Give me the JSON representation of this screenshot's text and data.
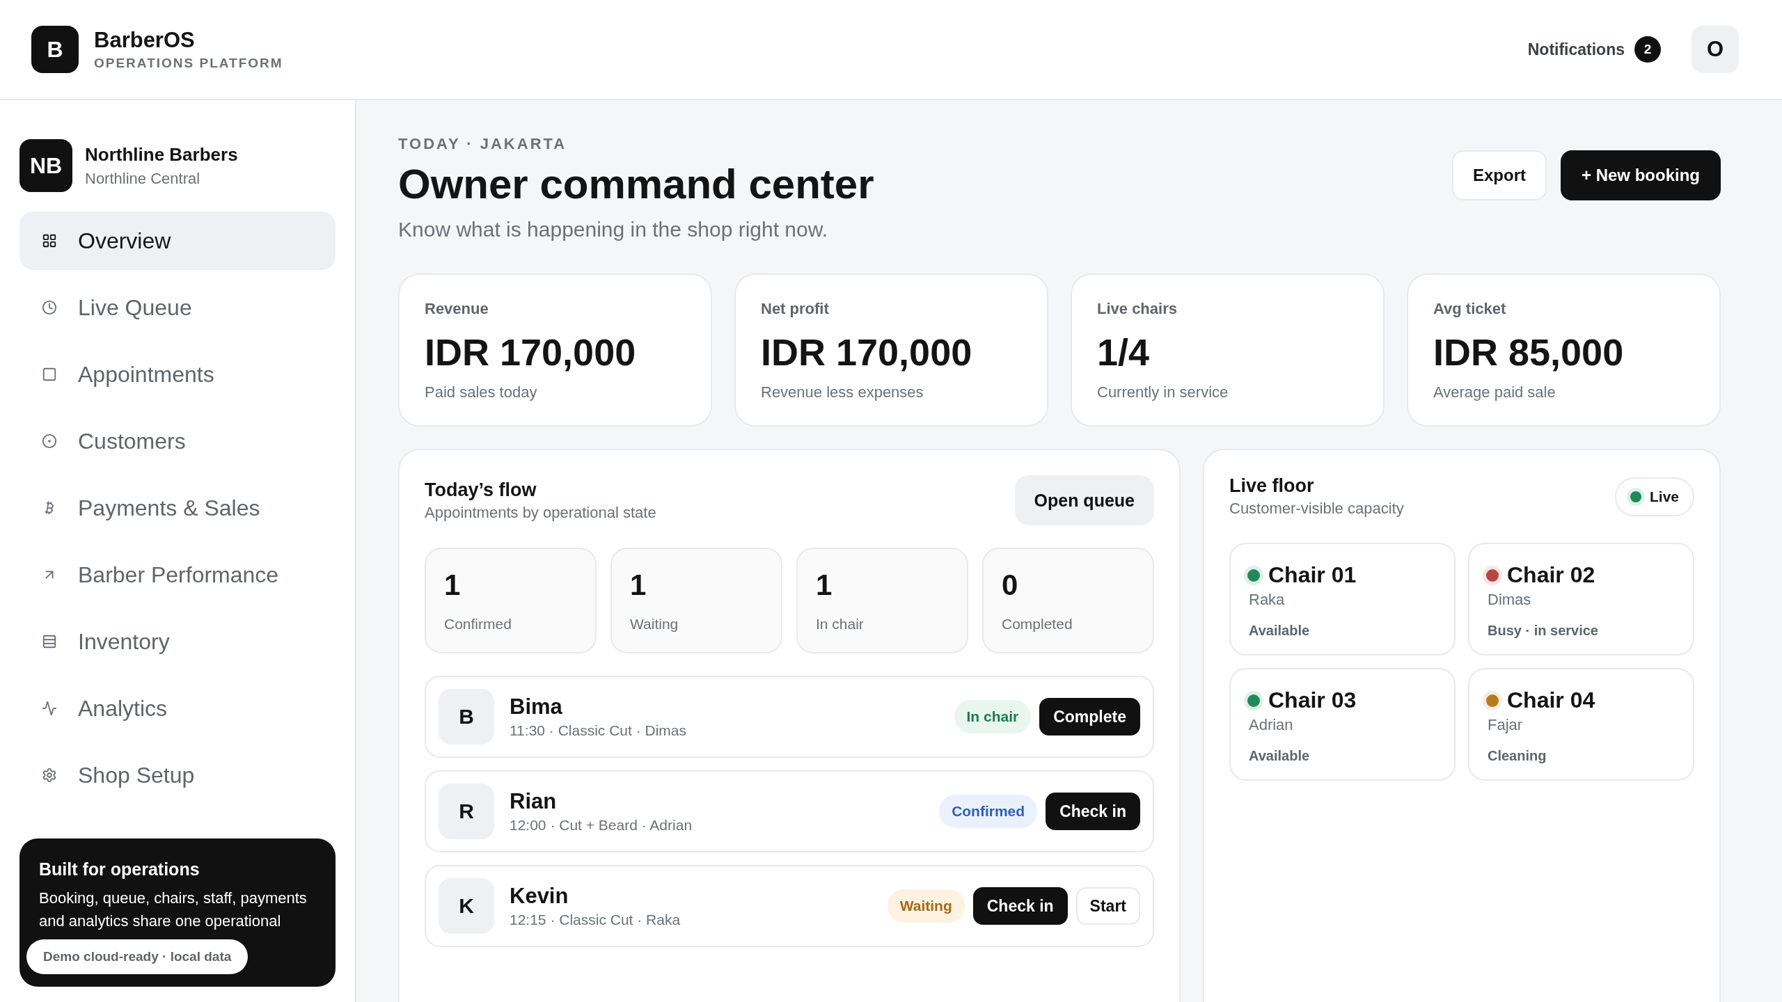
{
  "brand": {
    "logo": "B",
    "name": "BarberOS",
    "tagline": "OPERATIONS PLATFORM"
  },
  "header": {
    "notifications": "Notifications",
    "notification_count": "2",
    "avatar": "O"
  },
  "shop": {
    "initials": "NB",
    "name": "Northline Barbers",
    "branch": "Northline Central"
  },
  "nav": [
    {
      "label": "Overview",
      "selected": true
    },
    {
      "label": "Live Queue",
      "selected": false
    },
    {
      "label": "Appointments",
      "selected": false
    },
    {
      "label": "Customers",
      "selected": false
    },
    {
      "label": "Payments & Sales",
      "selected": false
    },
    {
      "label": "Barber Performance",
      "selected": false
    },
    {
      "label": "Inventory",
      "selected": false
    },
    {
      "label": "Analytics",
      "selected": false
    },
    {
      "label": "Shop Setup",
      "selected": false
    }
  ],
  "promo": {
    "title": "Built for operations",
    "text": "Booking, queue, chairs, staff, payments and analytics share one operational",
    "pill": "Demo cloud-ready · local data"
  },
  "page": {
    "eyebrow": "TODAY · JAKARTA",
    "title": "Owner command center",
    "subtitle": "Know what is happening in the shop right now.",
    "actions": [
      {
        "label": "Export",
        "kind": "secondary"
      },
      {
        "label": "+ New booking",
        "kind": "primary"
      }
    ]
  },
  "stats": [
    {
      "label": "Revenue",
      "value": "IDR 170,000",
      "note": "Paid sales today"
    },
    {
      "label": "Net profit",
      "value": "IDR 170,000",
      "note": "Revenue less expenses"
    },
    {
      "label": "Live chairs",
      "value": "1/4",
      "note": "Currently in service"
    },
    {
      "label": "Avg ticket",
      "value": "IDR 85,000",
      "note": "Average paid sale"
    }
  ],
  "flow": {
    "title": "Today’s flow",
    "subtitle": "Appointments by operational state",
    "button": "Open queue",
    "counts": [
      {
        "value": "1",
        "label": "Confirmed"
      },
      {
        "value": "1",
        "label": "Waiting"
      },
      {
        "value": "1",
        "label": "In chair"
      },
      {
        "value": "0",
        "label": "Completed"
      }
    ],
    "appointments": [
      {
        "initial": "B",
        "name": "Bima",
        "details": "11:30 · Classic Cut · Dimas",
        "status": "In chair",
        "kind": "in_chair",
        "actions": [
          {
            "label": "Complete",
            "kind": "primary"
          }
        ]
      },
      {
        "initial": "R",
        "name": "Rian",
        "details": "12:00 · Cut + Beard · Adrian",
        "status": "Confirmed",
        "kind": "confirmed",
        "actions": [
          {
            "label": "Check in",
            "kind": "primary"
          }
        ]
      },
      {
        "initial": "K",
        "name": "Kevin",
        "details": "12:15 · Classic Cut · Raka",
        "status": "Waiting",
        "kind": "waiting",
        "actions": [
          {
            "label": "Check in",
            "kind": "primary"
          },
          {
            "label": "Start",
            "kind": "secondary"
          }
        ]
      }
    ]
  },
  "floor": {
    "title": "Live floor",
    "subtitle": "Customer-visible capacity",
    "live": {
      "label": "Live",
      "color": "#1e8a5a"
    },
    "chairs": [
      {
        "name": "Chair 01",
        "barber": "Raka",
        "status": "Available",
        "color": "#1e8a5a"
      },
      {
        "name": "Chair 02",
        "barber": "Dimas",
        "status": "Busy · in service",
        "color": "#b84444"
      },
      {
        "name": "Chair 03",
        "barber": "Adrian",
        "status": "Available",
        "color": "#1e8a5a"
      },
      {
        "name": "Chair 04",
        "barber": "Fajar",
        "status": "Cleaning",
        "color": "#b7791f"
      }
    ]
  }
}
